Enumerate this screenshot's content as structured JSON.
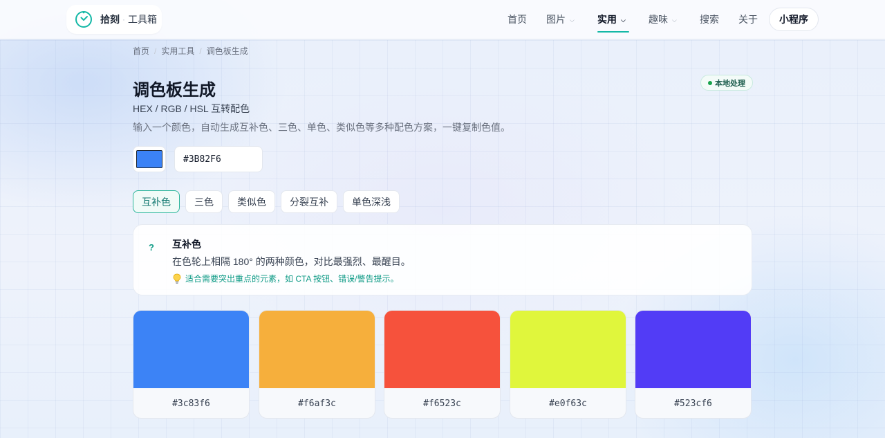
{
  "header": {
    "logo_name": "拾刻",
    "logo_sub": "工具箱",
    "nav": [
      {
        "label": "首页",
        "has_dropdown": false,
        "active": false
      },
      {
        "label": "图片",
        "has_dropdown": true,
        "active": false
      },
      {
        "label": "实用",
        "has_dropdown": true,
        "active": true
      },
      {
        "label": "趣味",
        "has_dropdown": true,
        "active": false
      },
      {
        "label": "搜索",
        "has_dropdown": false,
        "active": false
      },
      {
        "label": "关于",
        "has_dropdown": false,
        "active": false
      }
    ],
    "mini_program_label": "小程序"
  },
  "breadcrumb": [
    "首页",
    "实用工具",
    "调色板生成"
  ],
  "page": {
    "title": "调色板生成",
    "subtitle": "HEX / RGB / HSL 互转配色",
    "description": "输入一个颜色，自动生成互补色、三色、单色、类似色等多种配色方案，一键复制色值。",
    "badge": "本地处理"
  },
  "color_input": {
    "swatch_color": "#3B82F6",
    "hex_value": "#3B82F6"
  },
  "tabs": [
    {
      "label": "互补色",
      "active": true
    },
    {
      "label": "三色",
      "active": false
    },
    {
      "label": "类似色",
      "active": false
    },
    {
      "label": "分裂互补",
      "active": false
    },
    {
      "label": "单色深浅",
      "active": false
    }
  ],
  "info": {
    "icon": "question-icon",
    "title": "互补色",
    "text": "在色轮上相隔 180° 的两种颜色，对比最强烈、最醒目。",
    "tip": "适合需要突出重点的元素，如 CTA 按钮、错误/警告提示。"
  },
  "palette": [
    {
      "hex": "#3c83f6"
    },
    {
      "hex": "#f6af3c"
    },
    {
      "hex": "#f6523c"
    },
    {
      "hex": "#e0f63c"
    },
    {
      "hex": "#523cf6"
    }
  ],
  "colors": {
    "accent": "#14b8a6",
    "accent_text": "#0f766e"
  }
}
